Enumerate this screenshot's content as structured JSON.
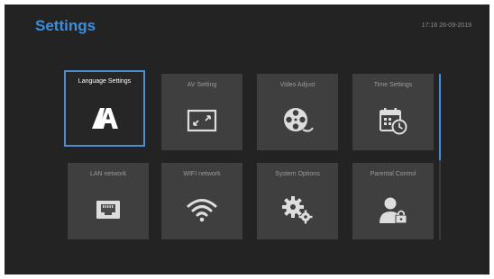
{
  "header": {
    "title": "Settings",
    "datetime": "17:16 26-09-2019"
  },
  "tiles": [
    {
      "label": "Language Settings",
      "icon": "language-icon",
      "selected": true
    },
    {
      "label": "AV Setting",
      "icon": "av-screen-icon",
      "selected": false
    },
    {
      "label": "Video Adjust",
      "icon": "film-reel-icon",
      "selected": false
    },
    {
      "label": "Time Settings",
      "icon": "calendar-clock-icon",
      "selected": false
    },
    {
      "label": "LAN network",
      "icon": "ethernet-port-icon",
      "selected": false
    },
    {
      "label": "WIFI network",
      "icon": "wifi-icon",
      "selected": false
    },
    {
      "label": "System Options",
      "icon": "gears-icon",
      "selected": false
    },
    {
      "label": "Parental Control",
      "icon": "user-lock-icon",
      "selected": false
    }
  ],
  "colors": {
    "accent": "#3a8fe0",
    "background": "#232323",
    "tile": "#3f3f3f",
    "selected_border": "#4a8ed0"
  }
}
